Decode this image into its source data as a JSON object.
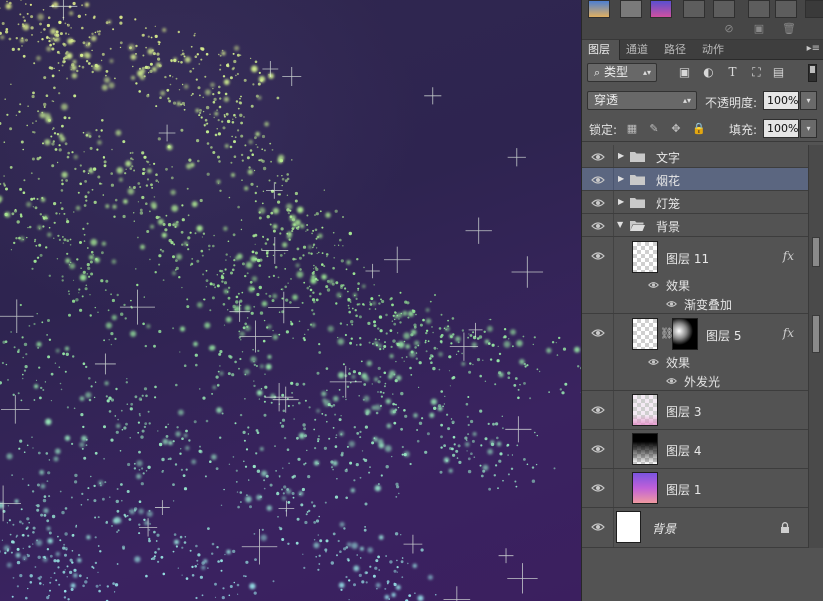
{
  "canvas": {
    "description_colors": {
      "bg": "#2e2450",
      "spark_green": "#b8f08a",
      "spark_cyan": "#9fe8e6"
    }
  },
  "panel": {
    "tabs": [
      {
        "label": "图层",
        "active": true
      },
      {
        "label": "通道",
        "active": false
      },
      {
        "label": "路径",
        "active": false
      },
      {
        "label": "动作",
        "active": false
      }
    ],
    "menu_icon": "panel-menu-icon",
    "filter": {
      "kind_label": "类型",
      "search_icon": "search-icon"
    },
    "filter_icons": [
      "image-filter-icon",
      "adjustment-filter-icon",
      "type-filter-icon",
      "shape-filter-icon",
      "smart-object-filter-icon"
    ],
    "blend": {
      "mode": "穿透",
      "opacity_label": "不透明度:",
      "opacity": "100%"
    },
    "lock": {
      "label": "锁定:",
      "fill_label": "填充:",
      "fill": "100%"
    },
    "layers": [
      {
        "type": "group",
        "name": "文字",
        "expanded": false,
        "selected": false
      },
      {
        "type": "group",
        "name": "烟花",
        "expanded": false,
        "selected": true
      },
      {
        "type": "group",
        "name": "灯笼",
        "expanded": false,
        "selected": false
      },
      {
        "type": "group",
        "name": "背景",
        "expanded": true,
        "selected": false
      },
      {
        "type": "layer",
        "name": "图层 11",
        "fx": "fx",
        "effects_label": "效果",
        "effects": [
          "渐变叠加"
        ]
      },
      {
        "type": "layer",
        "name": "图层 5",
        "fx": "fx",
        "effects_label": "效果",
        "effects": [
          "外发光"
        ],
        "has_mask": true
      },
      {
        "type": "layer",
        "name": "图层 3"
      },
      {
        "type": "layer",
        "name": "图层 4"
      },
      {
        "type": "layer",
        "name": "图层 1"
      },
      {
        "type": "background",
        "name": "背景",
        "locked": true
      }
    ]
  }
}
